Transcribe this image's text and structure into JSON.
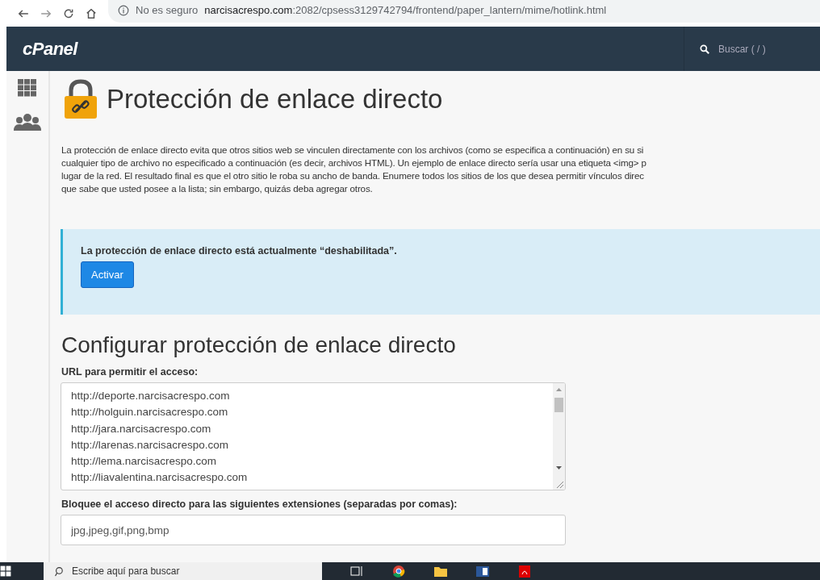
{
  "browser": {
    "security": "No es seguro",
    "url_host": "narcisacrespo.com",
    "url_path": ":2082/cpsess3129742794/frontend/paper_lantern/mime/hotlink.html"
  },
  "header": {
    "logo": "cPanel",
    "search_placeholder": "Buscar ( / )"
  },
  "page": {
    "title": "Protección de enlace directo",
    "intro_lines": [
      "La protección de enlace directo evita que otros sitios web se vinculen directamente con los archivos (como se especifica a continuación) en su si",
      "cualquier tipo de archivo no especificado a continuación (es decir, archivos HTML). Un ejemplo de enlace directo sería usar una etiqueta <img> p",
      "lugar de la red. El resultado final es que el otro sitio le roba su ancho de banda. Enumere todos los sitios de los que desea permitir vínculos direc",
      "que sabe que usted posee a la lista; sin embargo, quizás deba agregar otros."
    ],
    "status": {
      "message": "La protección de enlace directo está actualmente “deshabilitada”.",
      "button": "Activar"
    },
    "config_title": "Configurar protección de enlace directo",
    "urls_label": "URL para permitir el acceso:",
    "urls": [
      "http://deporte.narcisacrespo.com",
      "http://holguin.narcisacrespo.com",
      "http://jara.narcisacrespo.com",
      "http://larenas.narcisacrespo.com",
      "http://lema.narcisacrespo.com",
      "http://liavalentina.narcisacrespo.com"
    ],
    "extensions_label": "Bloquee el acceso directo para las siguientes extensiones (separadas por comas):",
    "extensions": "jpg,jpeg,gif,png,bmp"
  },
  "taskbar": {
    "search_placeholder": "Escribe aquí para buscar"
  }
}
